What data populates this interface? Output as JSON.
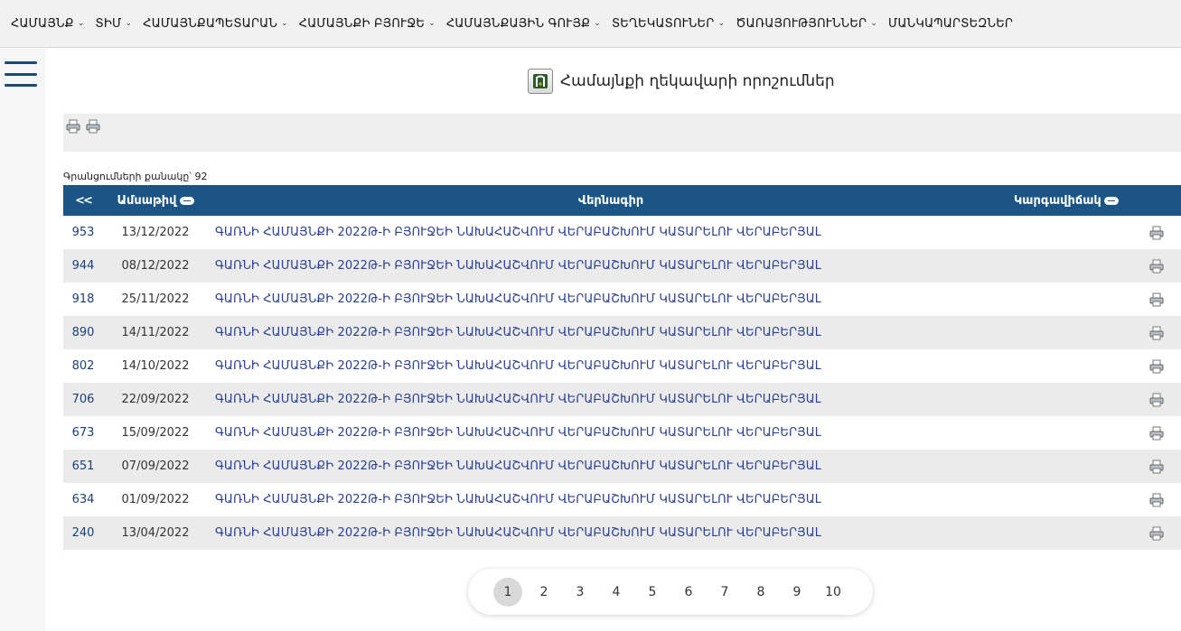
{
  "nav": {
    "items": [
      {
        "label": "ՀԱՄԱՅՆՔ",
        "chevron": true
      },
      {
        "label": "ՏԻՄ",
        "chevron": true
      },
      {
        "label": "ՀԱՄԱՅՆՔԱՊԵՏԱՐԱՆ",
        "chevron": true
      },
      {
        "label": "ՀԱՄԱՅՆՔԻ ԲՅՈՒՋԵ",
        "chevron": true
      },
      {
        "label": "ՀԱՄԱՅՆՔԱՅԻՆ ԳՈՒՅՔ",
        "chevron": true
      },
      {
        "label": "ՏԵՂԵԿԱՏՈՒՆԵՐ",
        "chevron": true
      },
      {
        "label": "ԾԱՌԱՅՈՒԹՅՈՒՆՆԵՐ",
        "chevron": true
      },
      {
        "label": "ՄԱՆԿԱՊԱՐՏԵԶՆԵՐ",
        "chevron": false
      }
    ]
  },
  "page": {
    "title": "Համայնքի ղեկավարի որոշումներ",
    "record_count": "Գրանցումների քանակը՝ 92"
  },
  "table": {
    "headers": {
      "num": "<<",
      "date": "Ամսաթիվ",
      "desc": "Վերնագիր",
      "status": "Կարգավիճակ"
    },
    "rows": [
      {
        "num": "953",
        "date": "13/12/2022",
        "desc": "ԳԱՌՆԻ ՀԱՄԱՅՆՔԻ 2022Թ-Ի ԲՅՈՒՋԵԻ ՆԱԽԱՀԱՇՎՈՒՄ ՎԵՐԱԲԱՇԽՈՒՄ ԿԱՏԱՐԵԼՈՒ ՎԵՐԱԲԵՐՅԱԼ"
      },
      {
        "num": "944",
        "date": "08/12/2022",
        "desc": "ԳԱՌՆԻ ՀԱՄԱՅՆՔԻ 2022Թ-Ի ԲՅՈՒՋԵԻ ՆԱԽԱՀԱՇՎՈՒՄ ՎԵՐԱԲԱՇԽՈՒՄ ԿԱՏԱՐԵԼՈՒ ՎԵՐԱԲԵՐՅԱԼ"
      },
      {
        "num": "918",
        "date": "25/11/2022",
        "desc": "ԳԱՌՆԻ ՀԱՄԱՅՆՔԻ 2022Թ-Ի ԲՅՈՒՋԵԻ ՆԱԽԱՀԱՇՎՈՒՄ ՎԵՐԱԲԱՇԽՈՒՄ ԿԱՏԱՐԵԼՈՒ ՎԵՐԱԲԵՐՅԱԼ"
      },
      {
        "num": "890",
        "date": "14/11/2022",
        "desc": "ԳԱՌՆԻ ՀԱՄԱՅՆՔԻ 2022Թ-Ի ԲՅՈՒՋԵԻ ՆԱԽԱՀԱՇՎՈՒՄ ՎԵՐԱԲԱՇԽՈՒՄ ԿԱՏԱՐԵԼՈՒ ՎԵՐԱԲԵՐՅԱԼ"
      },
      {
        "num": "802",
        "date": "14/10/2022",
        "desc": "ԳԱՌՆԻ ՀԱՄԱՅՆՔԻ 2022Թ-Ի ԲՅՈՒՋԵԻ ՆԱԽԱՀԱՇՎՈՒՄ ՎԵՐԱԲԱՇԽՈՒՄ ԿԱՏԱՐԵԼՈՒ ՎԵՐԱԲԵՐՅԱԼ"
      },
      {
        "num": "706",
        "date": "22/09/2022",
        "desc": "ԳԱՌՆԻ ՀԱՄԱՅՆՔԻ 2022Թ-Ի ԲՅՈՒՋԵԻ ՆԱԽԱՀԱՇՎՈՒՄ ՎԵՐԱԲԱՇԽՈՒՄ ԿԱՏԱՐԵԼՈՒ ՎԵՐԱԲԵՐՅԱԼ"
      },
      {
        "num": "673",
        "date": "15/09/2022",
        "desc": "ԳԱՌՆԻ ՀԱՄԱՅՆՔԻ 2022Թ-Ի ԲՅՈՒՋԵԻ ՆԱԽԱՀԱՇՎՈՒՄ ՎԵՐԱԲԱՇԽՈՒՄ ԿԱՏԱՐԵԼՈՒ ՎԵՐԱԲԵՐՅԱԼ"
      },
      {
        "num": "651",
        "date": "07/09/2022",
        "desc": "ԳԱՌՆԻ ՀԱՄԱՅՆՔԻ 2022Թ-Ի ԲՅՈՒՋԵԻ ՆԱԽԱՀԱՇՎՈՒՄ ՎԵՐԱԲԱՇԽՈՒՄ ԿԱՏԱՐԵԼՈՒ ՎԵՐԱԲԵՐՅԱԼ"
      },
      {
        "num": "634",
        "date": "01/09/2022",
        "desc": "ԳԱՌՆԻ ՀԱՄԱՅՆՔԻ 2022Թ-Ի ԲՅՈՒՋԵԻ ՆԱԽԱՀԱՇՎՈՒՄ ՎԵՐԱԲԱՇԽՈՒՄ ԿԱՏԱՐԵԼՈՒ ՎԵՐԱԲԵՐՅԱԼ"
      },
      {
        "num": "240",
        "date": "13/04/2022",
        "desc": "ԳԱՌՆԻ ՀԱՄԱՅՆՔԻ 2022Թ-Ի ԲՅՈՒՋԵԻ ՆԱԽԱՀԱՇՎՈՒՄ ՎԵՐԱԲԱՇԽՈՒՄ ԿԱՏԱՐԵԼՈՒ ՎԵՐԱԲԵՐՅԱԼ"
      }
    ]
  },
  "pagination": {
    "pages": [
      "1",
      "2",
      "3",
      "4",
      "5",
      "6",
      "7",
      "8",
      "9",
      "10"
    ],
    "active": "1"
  },
  "colors": {
    "header_bg": "#1a5586",
    "link": "#2a3f93",
    "hamburger": "#1a4a72"
  }
}
